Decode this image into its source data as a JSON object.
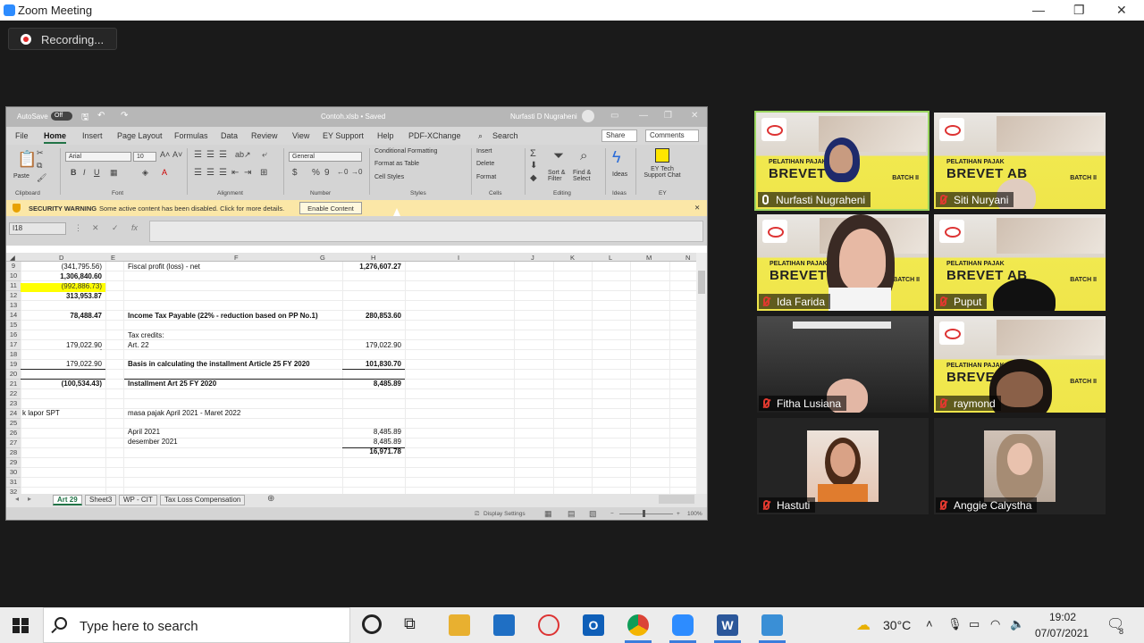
{
  "window": {
    "title": "Zoom Meeting",
    "minimize": "—",
    "maximize": "❐",
    "close": "✕"
  },
  "recording": {
    "label": "Recording..."
  },
  "excel": {
    "autosave_label": "AutoSave",
    "autosave_state": "Off",
    "file_name": "Contoh.xlsb • Saved",
    "user_name": "Nurfasti D Nugraheni",
    "tabs": [
      "File",
      "Home",
      "Insert",
      "Page Layout",
      "Formulas",
      "Data",
      "Review",
      "View",
      "EY Support",
      "Help",
      "PDF-XChange"
    ],
    "active_tab": "Home",
    "search_label": "Search",
    "share_label": "Share",
    "comments_label": "Comments",
    "ribbon": {
      "paste": "Paste",
      "font_name": "Arial",
      "font_size": "10",
      "number_format": "General",
      "cond_formatting": "Conditional Formatting",
      "format_table": "Format as Table",
      "cell_styles": "Cell Styles",
      "insert": "Insert",
      "delete": "Delete",
      "format": "Format",
      "sort_filter": "Sort & Filter",
      "find_select": "Find & Select",
      "ideas": "Ideas",
      "ey_tech": "EY Tech Support Chat",
      "groups": [
        "Clipboard",
        "Font",
        "Alignment",
        "Number",
        "Styles",
        "Cells",
        "Editing",
        "Ideas",
        "EY"
      ]
    },
    "security": {
      "title": "SECURITY WARNING",
      "message": "Some active content has been disabled. Click for more details.",
      "button": "Enable Content"
    },
    "name_box": "I18",
    "fx": "fx",
    "columns": [
      "D",
      "E",
      "F",
      "G",
      "H",
      "I",
      "J",
      "K",
      "L",
      "M",
      "N"
    ],
    "rows": [
      "9",
      "10",
      "11",
      "12",
      "13",
      "14",
      "15",
      "16",
      "17",
      "18",
      "19",
      "20",
      "21",
      "22",
      "23",
      "24",
      "25",
      "26",
      "27",
      "28",
      "29",
      "30",
      "31",
      "32"
    ],
    "cells": {
      "d9": "(341,795.56)",
      "f9": "Fiscal profit (loss) - net",
      "h9": "1,276,607.27",
      "d10": "1,306,840.60",
      "d11": "(992,886.73)",
      "d12": "313,953.87",
      "d14": "78,488.47",
      "f14": "Income Tax Payable (22% - reduction based on PP No.1)",
      "h14": "280,853.60",
      "f16": "Tax credits:",
      "d17": "179,022.90",
      "f17": "Art. 22",
      "h17": "179,022.90",
      "d18": "-",
      "d19": "179,022.90",
      "f19": "Basis in calculating the installment Article 25 FY 2020",
      "h19": "101,830.70",
      "d21": "(100,534.43)",
      "f21": "Installment Art 25 FY 2020",
      "h21": "8,485.89",
      "d24": "k lapor SPT",
      "f24": "masa pajak April 2021 - Maret 2022",
      "f26": "April 2021",
      "h26": "8,485.89",
      "f27": "desember 2021",
      "h27": "8,485.89",
      "h28": "16,971.78"
    },
    "sheet_tabs": [
      "Art 29",
      "Sheet3",
      "WP - CIT",
      "Tax Loss Compensation"
    ],
    "active_sheet": "Art 29",
    "status": {
      "display_settings": "Display Settings",
      "zoom": "100%"
    }
  },
  "participants": [
    {
      "name": "Nurfasti Nugraheni",
      "muted": false,
      "active": true
    },
    {
      "name": "Siti Nuryani",
      "muted": true
    },
    {
      "name": "Ida Farida",
      "muted": true
    },
    {
      "name": "Puput",
      "muted": true
    },
    {
      "name": "Fitha Lusiana",
      "muted": true
    },
    {
      "name": "raymond",
      "muted": true
    },
    {
      "name": "Hastuti",
      "muted": true
    },
    {
      "name": "Anggie Calystha",
      "muted": true
    }
  ],
  "banner": {
    "top": "PELATIHAN PAJAK",
    "big": "BREVET AB",
    "batch": "BATCH II"
  },
  "taskbar": {
    "search_placeholder": "Type here to search",
    "weather": "30°C",
    "time": "19:02",
    "date": "07/07/2021",
    "notifications": "8"
  }
}
